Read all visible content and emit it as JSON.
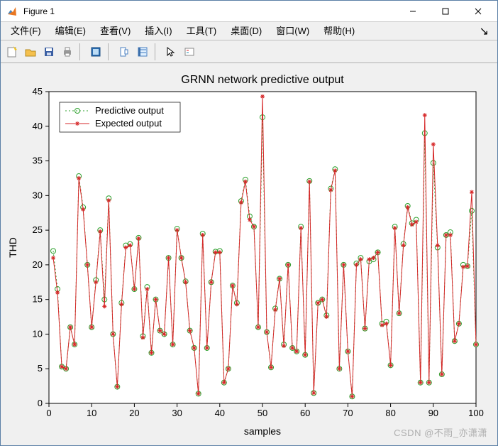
{
  "window": {
    "title": "Figure 1"
  },
  "menus": {
    "file": "文件(F)",
    "edit": "编辑(E)",
    "view": "查看(V)",
    "insert": "插入(I)",
    "tools": "工具(T)",
    "desktop": "桌面(D)",
    "window": "窗口(W)",
    "help": "帮助(H)"
  },
  "toolbar_icons": [
    "new-figure-icon",
    "open-icon",
    "save-icon",
    "print-icon",
    "sep",
    "link-icon",
    "sep",
    "data-cursor-icon",
    "colorbar-icon",
    "sep",
    "pointer-icon",
    "legend-icon"
  ],
  "watermark": "CSDN @不雨_亦潇潇",
  "chart_data": {
    "type": "line",
    "title": "GRNN network predictive output",
    "xlabel": "samples",
    "ylabel": "THD",
    "xlim": [
      0,
      100
    ],
    "ylim": [
      0,
      45
    ],
    "xticks": [
      0,
      10,
      20,
      30,
      40,
      50,
      60,
      70,
      80,
      90,
      100
    ],
    "yticks": [
      0,
      5,
      10,
      15,
      20,
      25,
      30,
      35,
      40,
      45
    ],
    "legend": {
      "position": "upper-left",
      "entries": [
        "Predictive output",
        "Expected output"
      ]
    },
    "colors": {
      "predictive": "#2ca02c",
      "expected": "#d62728",
      "axis": "#000000",
      "bg": "#ffffff"
    },
    "x": [
      1,
      2,
      3,
      4,
      5,
      6,
      7,
      8,
      9,
      10,
      11,
      12,
      13,
      14,
      15,
      16,
      17,
      18,
      19,
      20,
      21,
      22,
      23,
      24,
      25,
      26,
      27,
      28,
      29,
      30,
      31,
      32,
      33,
      34,
      35,
      36,
      37,
      38,
      39,
      40,
      41,
      42,
      43,
      44,
      45,
      46,
      47,
      48,
      49,
      50,
      51,
      52,
      53,
      54,
      55,
      56,
      57,
      58,
      59,
      60,
      61,
      62,
      63,
      64,
      65,
      66,
      67,
      68,
      69,
      70,
      71,
      72,
      73,
      74,
      75,
      76,
      77,
      78,
      79,
      80,
      81,
      82,
      83,
      84,
      85,
      86,
      87,
      88,
      89,
      90,
      91,
      92,
      93,
      94,
      95,
      96,
      97,
      98,
      99,
      100
    ],
    "series": [
      {
        "name": "Predictive output",
        "marker": "o",
        "values": [
          22,
          16.5,
          5.3,
          5,
          11,
          8.5,
          32.8,
          28.3,
          20,
          11,
          17.8,
          25,
          15,
          29.6,
          10,
          2.4,
          14.5,
          22.8,
          23,
          16.5,
          23.9,
          9.7,
          16.8,
          7.3,
          15,
          10.5,
          10,
          21,
          8.5,
          25.2,
          21,
          17.6,
          10.5,
          8,
          1.4,
          24.5,
          8,
          17.5,
          21.9,
          22,
          3,
          5,
          17,
          14.5,
          29.2,
          32.3,
          27,
          25.5,
          11,
          41.3,
          10.3,
          5.2,
          13.7,
          18,
          8.5,
          20,
          8,
          7.5,
          25.5,
          7,
          32.1,
          1.5,
          14.5,
          15,
          12.7,
          31,
          33.8,
          5,
          20,
          7.5,
          1,
          20.2,
          21,
          10.8,
          20.5,
          20.8,
          21.8,
          11.5,
          11.8,
          5.5,
          25.5,
          13,
          23,
          28.5,
          26,
          26.5,
          3,
          39,
          3,
          34.7,
          22.5,
          4.2,
          24.3,
          24.7,
          9,
          11.5,
          20,
          19.8,
          27.8,
          8.5
        ]
      },
      {
        "name": "Expected output",
        "marker": "*",
        "values": [
          21,
          16,
          5.3,
          5,
          11,
          8.5,
          32.5,
          28,
          20,
          11,
          17.5,
          24.8,
          14,
          29.3,
          10,
          2.4,
          14.3,
          22.5,
          22.8,
          16.5,
          23.8,
          9.5,
          16.5,
          7.3,
          15,
          10.5,
          10,
          21,
          8.5,
          25,
          21,
          17.5,
          10.5,
          8,
          1.4,
          24.3,
          8,
          17.5,
          21.8,
          21.8,
          3,
          5,
          17,
          14.3,
          29,
          32,
          26.5,
          25.5,
          11,
          44.3,
          10.3,
          5.2,
          13.5,
          18,
          8.3,
          20,
          8,
          7.5,
          25.3,
          7,
          32,
          1.5,
          14.5,
          15,
          12.5,
          30.8,
          33.6,
          5,
          20,
          7.5,
          1,
          20,
          20.8,
          10.8,
          20.8,
          21,
          21.8,
          11.3,
          11.5,
          5.5,
          25.3,
          13,
          22.8,
          28.3,
          25.8,
          26.2,
          3,
          41.6,
          3,
          37.4,
          22.8,
          4.2,
          24.3,
          24.3,
          9,
          11.5,
          19.7,
          19.8,
          30.5,
          8.5
        ]
      }
    ]
  }
}
